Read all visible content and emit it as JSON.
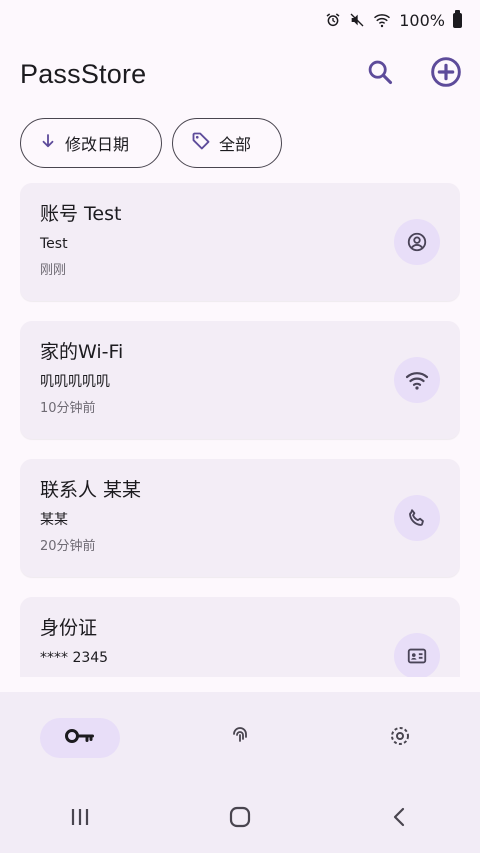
{
  "status_bar": {
    "battery_text": "100%",
    "icons": [
      "alarm-icon",
      "mute-icon",
      "wifi-icon",
      "battery-icon"
    ]
  },
  "app": {
    "title": "PassStore",
    "actions": [
      "search-icon",
      "add-circle-icon"
    ]
  },
  "chips": {
    "sort": {
      "label": "修改日期",
      "icon": "arrow-down-icon"
    },
    "filter": {
      "label": "全部",
      "icon": "tag-icon"
    }
  },
  "items": [
    {
      "title": "账号 Test",
      "subtitle": "Test",
      "time": "刚刚",
      "icon": "account-circle-icon"
    },
    {
      "title": "家的Wi-Fi",
      "subtitle": "叽叽叽叽叽",
      "time": "10分钟前",
      "icon": "wifi-icon"
    },
    {
      "title": "联系人 某某",
      "subtitle": "某某",
      "time": "20分钟前",
      "icon": "phone-icon"
    },
    {
      "title": "身份证",
      "subtitle": "**** 2345",
      "time": "",
      "icon": "id-card-icon"
    }
  ],
  "bottom_nav": {
    "items": [
      {
        "icon": "key-icon",
        "active": true
      },
      {
        "icon": "fingerprint-icon",
        "active": false
      },
      {
        "icon": "settings-icon",
        "active": false
      }
    ]
  },
  "system_nav": [
    "recents-icon",
    "home-icon",
    "back-icon"
  ],
  "colors": {
    "background": "#fdf8fd",
    "card": "#f3edf6",
    "accent": "#5d4b9a",
    "icon_container": "#e8def8",
    "nav": "#f2ecf6"
  }
}
